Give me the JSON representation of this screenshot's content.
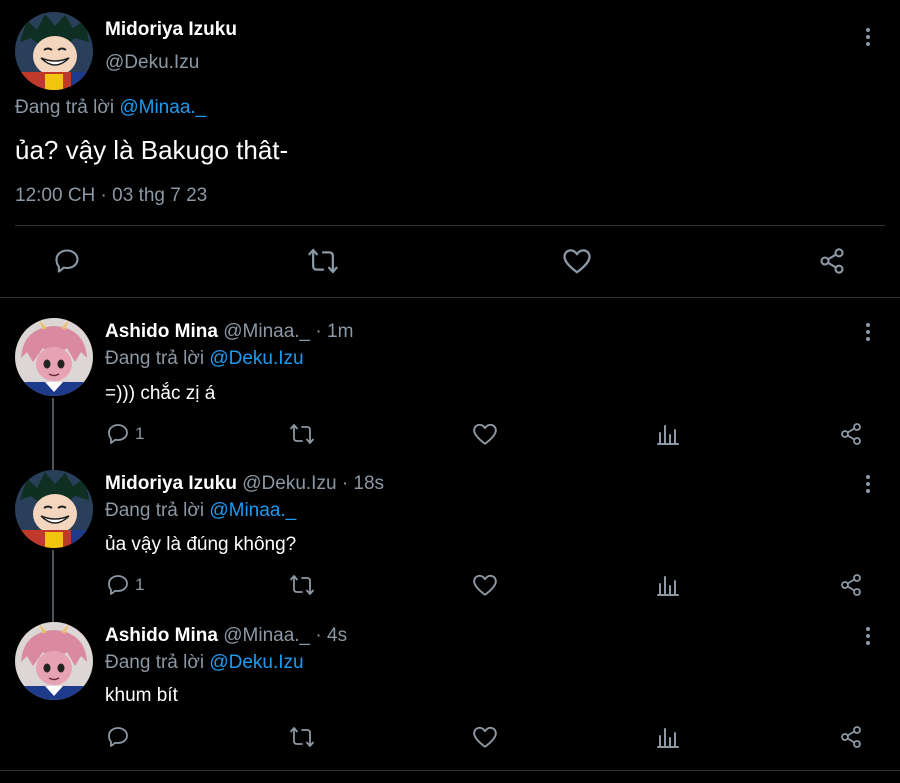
{
  "main_tweet": {
    "display_name": "Midoriya Izuku",
    "handle": "@Deku.Izu",
    "reply_prefix": "Đang trả lời",
    "reply_to": "@Minaa._",
    "text": "ủa? vậy là Bakugo thât-",
    "timestamp": "12:00 CH · 03 thg 7 23",
    "actions": [
      "reply-icon",
      "retweet-icon",
      "like-icon",
      "share-icon"
    ]
  },
  "replies": [
    {
      "display_name": "Ashido Mina",
      "handle": "@Minaa._",
      "time": "· 1m",
      "reply_prefix": "Đang trả lời",
      "reply_to": "@Deku.Izu",
      "text": "=))) chắc zị á",
      "reply_count": "1"
    },
    {
      "display_name": "Midoriya Izuku",
      "handle": "@Deku.Izu",
      "time": "· 18s",
      "reply_prefix": "Đang trả lời",
      "reply_to": "@Minaa._",
      "text": "ủa vậy là đúng không?",
      "reply_count": "1"
    },
    {
      "display_name": "Ashido Mina",
      "handle": "@Minaa._",
      "time": "· 4s",
      "reply_prefix": "Đang trả lời",
      "reply_to": "@Deku.Izu",
      "text": "khum bít",
      "reply_count": ""
    }
  ],
  "colors": {
    "background": "#000000",
    "link": "#1d9bf0",
    "muted": "#8b98a5",
    "divider": "#2f3336"
  }
}
